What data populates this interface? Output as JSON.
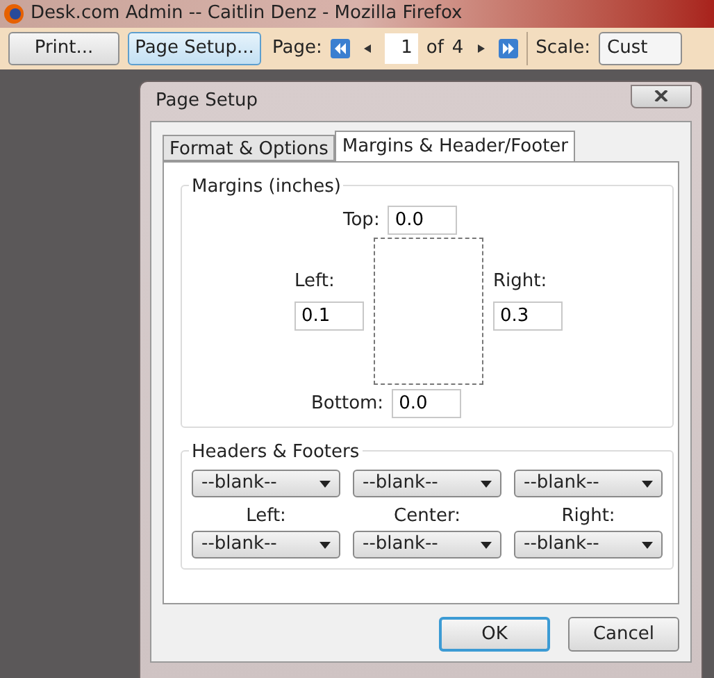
{
  "browser": {
    "title": "Desk.com Admin -- Caitlin Denz - Mozilla Firefox"
  },
  "toolbar": {
    "buttons": [
      {
        "label": "Print...",
        "focused": false
      },
      {
        "label": "Page Setup...",
        "focused": true
      }
    ],
    "page_label": "Page:",
    "page_value": "1",
    "of_label": "of",
    "page_count": "4",
    "scale_label": "Scale:",
    "scale_value": "Cust"
  },
  "dialog": {
    "title": "Page Setup",
    "tabs": [
      {
        "label": "Format & Options",
        "selected": false
      },
      {
        "label": "Margins & Header/Footer",
        "selected": true
      }
    ],
    "margins": {
      "title": "Margins (inches)",
      "fields": [
        {
          "label": "Top:",
          "value": "0.0"
        },
        {
          "label": "Left:",
          "value": "0.1"
        },
        {
          "label": "Right:",
          "value": "0.3"
        },
        {
          "label": "Bottom:",
          "value": "0.0"
        }
      ]
    },
    "headers_footers": {
      "title": "Headers & Footers",
      "headers": [
        "--blank--",
        "--blank--",
        "--blank--"
      ],
      "labels": [
        "Left:",
        "Center:",
        "Right:"
      ],
      "footers": [
        "--blank--",
        "--blank--",
        "--blank--"
      ]
    },
    "buttons": [
      {
        "label": "OK",
        "focused": true
      },
      {
        "label": "Cancel",
        "focused": false
      }
    ]
  }
}
